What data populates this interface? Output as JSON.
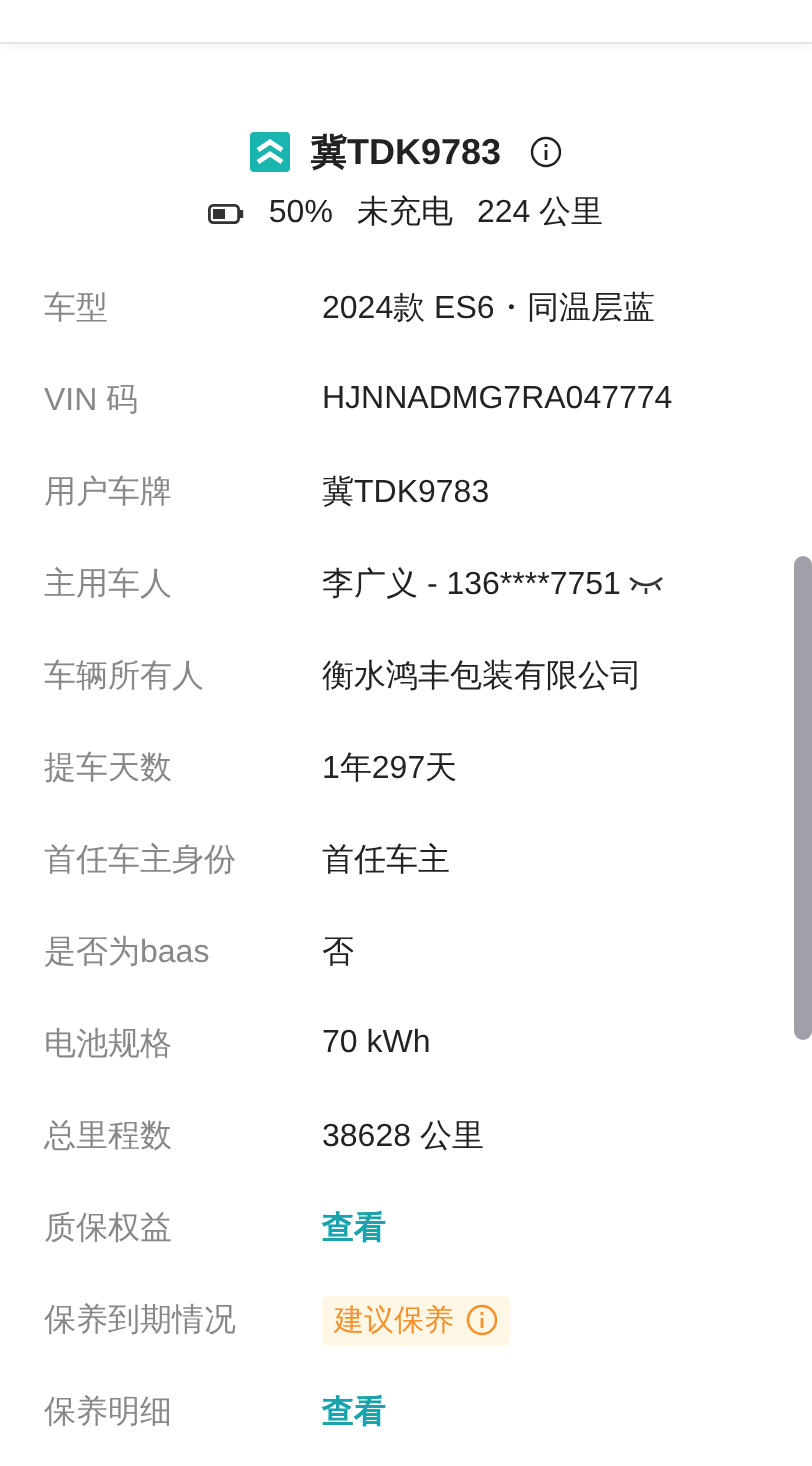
{
  "header": {
    "plate": "冀TDK9783",
    "battery": "50%",
    "charging": "未充电",
    "range": "224 公里"
  },
  "rows": [
    {
      "label": "车型",
      "kind": "text",
      "value": "2024款 ES6・同温层蓝"
    },
    {
      "label": "VIN 码",
      "kind": "text",
      "value": "HJNNADMG7RA047774"
    },
    {
      "label": "用户车牌",
      "kind": "text",
      "value": "冀TDK9783"
    },
    {
      "label": "主用车人",
      "kind": "phone",
      "value": "李广义 - 136****7751"
    },
    {
      "label": "车辆所有人",
      "kind": "text",
      "value": "衡水鸿丰包装有限公司"
    },
    {
      "label": "提车天数",
      "kind": "text",
      "value": "1年297天"
    },
    {
      "label": "首任车主身份",
      "kind": "text",
      "value": "首任车主"
    },
    {
      "label": "是否为baas",
      "kind": "text",
      "value": "否"
    },
    {
      "label": "电池规格",
      "kind": "text",
      "value": "70 kWh"
    },
    {
      "label": "总里程数",
      "kind": "text",
      "value": "38628 公里"
    },
    {
      "label": "质保权益",
      "kind": "link",
      "value": "查看"
    },
    {
      "label": "保养到期情况",
      "kind": "tag",
      "value": "建议保养"
    },
    {
      "label": "保养明细",
      "kind": "link",
      "value": "查看"
    }
  ]
}
